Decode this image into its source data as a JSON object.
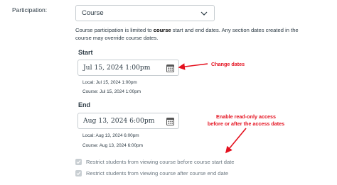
{
  "participation": {
    "label": "Participation:",
    "selected": "Course",
    "help_prefix": "Course participation is limited to ",
    "help_bold": "course",
    "help_suffix": " start and end dates. Any section dates created in the course may override course dates."
  },
  "start": {
    "heading": "Start",
    "value": "Jul 15, 2024 1:00pm",
    "local": "Local: Jul 15, 2024 1:00pm",
    "course": "Course: Jul 15, 2024 1:00pm"
  },
  "end": {
    "heading": "End",
    "value": "Aug 13, 2024 6:00pm",
    "local": "Local: Aug 13, 2024 6:00pm",
    "course": "Course: Aug 13, 2024 6:00pm"
  },
  "annotations": {
    "change_dates": "Change dates",
    "read_only_line1": "Enable read-only access",
    "read_only_line2": "before or after the access dates"
  },
  "restrictions": {
    "before": "Restrict students from viewing course before course start date",
    "after": "Restrict students from viewing course after course end date"
  },
  "colors": {
    "annotation": "#e4101e",
    "checkbox_disabled": "#c8ced2"
  }
}
